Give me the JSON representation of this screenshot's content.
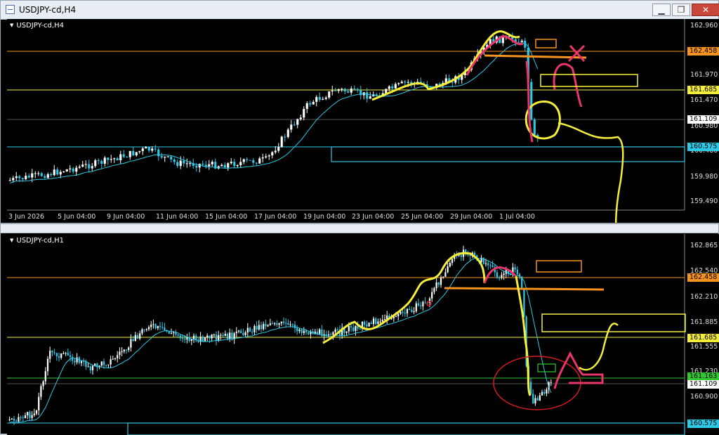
{
  "window1": {
    "title": "USDJPY-cd,H4",
    "symbol": "USDJPY-cd,H4",
    "price_labels": [
      "162.960",
      "161.970",
      "161.470",
      "160.980",
      "160.480",
      "159.980",
      "159.490"
    ],
    "level_tags": [
      {
        "text": "162.458",
        "bg": "#f7931e",
        "fg": "#000"
      },
      {
        "text": "161.685",
        "bg": "#f5ef3c",
        "fg": "#000"
      },
      {
        "text": "161.109",
        "bg": "#ffffff",
        "fg": "#000"
      },
      {
        "text": "160.575",
        "bg": "#2ec9e6",
        "fg": "#000"
      }
    ],
    "time_labels": [
      "3 Jun 2026",
      "5 Jun 04:00",
      "9 Jun 04:00",
      "11 Jun 04:00",
      "15 Jun 04:00",
      "17 Jun 04:00",
      "19 Jun 04:00",
      "23 Jun 04:00",
      "25 Jun 04:00",
      "29 Jun 04:00",
      "1 Jul 04:00"
    ],
    "buttons": {
      "minimize": "▁",
      "restore": "❐",
      "close": "✕"
    }
  },
  "window2": {
    "symbol": "USDJPY-cd,H1",
    "price_labels": [
      "162.865",
      "162.540",
      "162.210",
      "161.885",
      "161.555",
      "161.230",
      "160.900"
    ],
    "level_tags": [
      {
        "text": "162.458",
        "bg": "#f7931e",
        "fg": "#000"
      },
      {
        "text": "161.685",
        "bg": "#f5ef3c",
        "fg": "#000"
      },
      {
        "text": "161.163",
        "bg": "#32c832",
        "fg": "#000"
      },
      {
        "text": "161.109",
        "bg": "#ffffff",
        "fg": "#000"
      },
      {
        "text": "160.575",
        "bg": "#2ec9e6",
        "fg": "#000"
      }
    ]
  },
  "colors": {
    "orange": "#f7931e",
    "yellow": "#f5ef3c",
    "cyan": "#2ec9e6",
    "pink": "#e8366b",
    "green": "#32c832",
    "red": "#d21e1e",
    "candle_up": "#ffffff",
    "candle_down": "#2ec9e6"
  }
}
